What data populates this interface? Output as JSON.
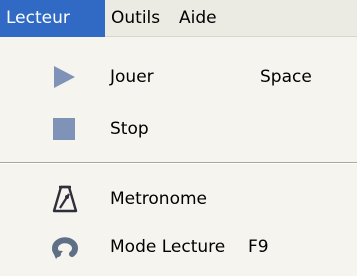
{
  "menubar": {
    "items": [
      {
        "label": "Lecteur",
        "active": true
      },
      {
        "label": "Outils",
        "active": false
      },
      {
        "label": "Aide",
        "active": false
      }
    ]
  },
  "menu": {
    "items": [
      {
        "label": "Jouer",
        "shortcut": "Space",
        "icon": "play-icon"
      },
      {
        "label": "Stop",
        "icon": "stop-icon"
      },
      {
        "label": "Metronome",
        "icon": "metronome-icon"
      },
      {
        "label": "Mode Lecture",
        "shortcut": "F9",
        "icon": "loop-icon"
      }
    ]
  },
  "colors": {
    "menu_background": "#f5f4ee",
    "menubar_background": "#ecebe3",
    "selection": "#316ac5",
    "selection_text": "#ffffff",
    "icon_blue": "#7f93b8",
    "separator": "#aca899"
  }
}
